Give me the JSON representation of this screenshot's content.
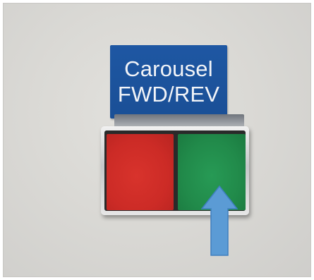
{
  "sign": {
    "line1": "Carousel",
    "line2": "FWD/REV",
    "background_color": "#1a4f96",
    "text_color": "#f2f4f8"
  },
  "buttons": {
    "left": {
      "icon": "red-push-button",
      "color": "#cc2b26"
    },
    "right": {
      "icon": "green-push-button",
      "color": "#218a4a"
    }
  },
  "annotation": {
    "icon": "up-arrow-icon",
    "color": "#5b9bd5",
    "points_to": "green-push-button"
  }
}
